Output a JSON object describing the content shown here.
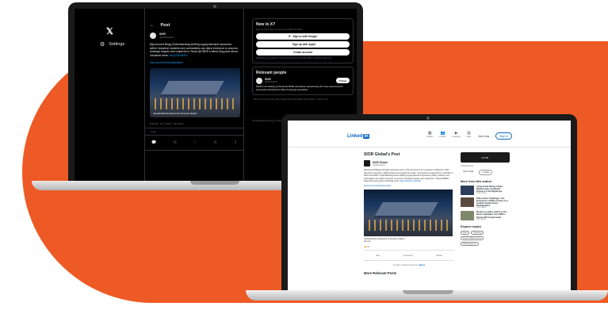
{
  "colors": {
    "background": "#ffffff",
    "orange_accent": "#ee5a25",
    "x_blue": "#1d9bf0",
    "linkedin_blue": "#0a66c2"
  },
  "x": {
    "logo": "𝕏",
    "settings_label": "Settings",
    "post_header": "Post",
    "author_name": "SIOR",
    "author_handle": "@SIORglobal",
    "post_text": "[Sponsored Blog] Understanding shifting supply/demand dynamics within industrial markets and submarkets can allow investors to uncover strategic targets and outperform. Read @CBRE's latest blog post about industrial rents:",
    "post_link": "bit.ly/3SOBr8V",
    "hashtags": "#sponsored #industrialmarket",
    "image_caption": "Industrial Rents Respond to Dynamic Market",
    "post_meta": "8:58 AM · Apr 9, 2024 · 160 Views",
    "like_count": "1 Like",
    "actions": [
      "💬",
      "⟲",
      "♡",
      "⊓",
      "⇪"
    ],
    "new_box": {
      "title": "New to X?",
      "subtitle": "Sign up now to get your own personalized timeline!",
      "google_button": "Sign in with Google",
      "apple_button": "Sign up with Apple",
      "create_button": "Create account",
      "terms": "By signing up, you agree to the Terms of Service and Privacy Policy, including Cookie Use."
    },
    "relevant": {
      "title": "Relevant people",
      "name": "SIOR",
      "handle": "@SIORglobal",
      "follow_label": "Follow",
      "bio": "SIOR is the leading professional #CRE association representing the most experienced & successful industrial and office brokerage specialists."
    },
    "aside_text": "Something went wrong. Try reloading.",
    "retry_button": "Retry",
    "footer": "Terms of Service Privacy Policy Cookie Policy Accessibility Ads info More © 2024 X Corp."
  },
  "linkedin": {
    "logo_text": "Linked",
    "logo_in": "in",
    "nav": [
      {
        "icon": "▦",
        "label": "Articles"
      },
      {
        "icon": "👥",
        "label": "People"
      },
      {
        "icon": "▶",
        "label": "Learning"
      },
      {
        "icon": "▤",
        "label": "Jobs"
      }
    ],
    "join_label": "Join now",
    "signin_label": "Sign in",
    "post_title": "SIOR Global's Post",
    "author_name": "SIOR Global",
    "author_sub": "3,453 followers",
    "post_text": "[Sponsored Blog] Industrial vacancies are on the rise due to an increase in deliveries. With demand reverting to slightly below pre-pandemic levels, rent growth is expected to moderate in 2024 and 2025. Understanding these shifting supply/demand dynamics within markets and submarkets can allow investors to uncover strategic targets and outperform. Read CBRE's latest blog post about industrial rents:",
    "post_link": "https://lnkd.in/eukbHrb",
    "hashtags": "#sponsored #industrialmarket",
    "image_caption": "Industrial Rents Respond to Dynamic Market",
    "image_source": "sior.org",
    "reaction_count": "10",
    "actions": [
      "Like",
      "Comment",
      "Share"
    ],
    "view_text": "To view or add a comment,",
    "view_link": "sign in",
    "more_posts": "More Relevant Posts",
    "card_banner": "SIOR",
    "card_sub": "3,453 followers",
    "card_view": "View Profile",
    "card_follow": "+ Follow",
    "more_from": "More from this author",
    "articles": [
      {
        "title": "Using Social Media to Build Relationships and Market Presence in the Digital Age",
        "by": "SIOR Global",
        "thumb": "#2b3f5c"
      },
      {
        "title": "Office Sector Challenges: The Emergence of Office Condos as a Solution Amidst Sector Reimagination",
        "by": "SIOR Global",
        "thumb": "#5b4a3f"
      },
      {
        "title": "Business Leaders Gather at The Beach: Highlights from SIOR's Spring 2024 Amelia Island",
        "by": "SIOR Global",
        "thumb": "#7e8a6b"
      }
    ],
    "explore": "Explore topics",
    "topics": [
      "Sales",
      "Marketing",
      "Business Administration",
      "HR Management"
    ]
  }
}
